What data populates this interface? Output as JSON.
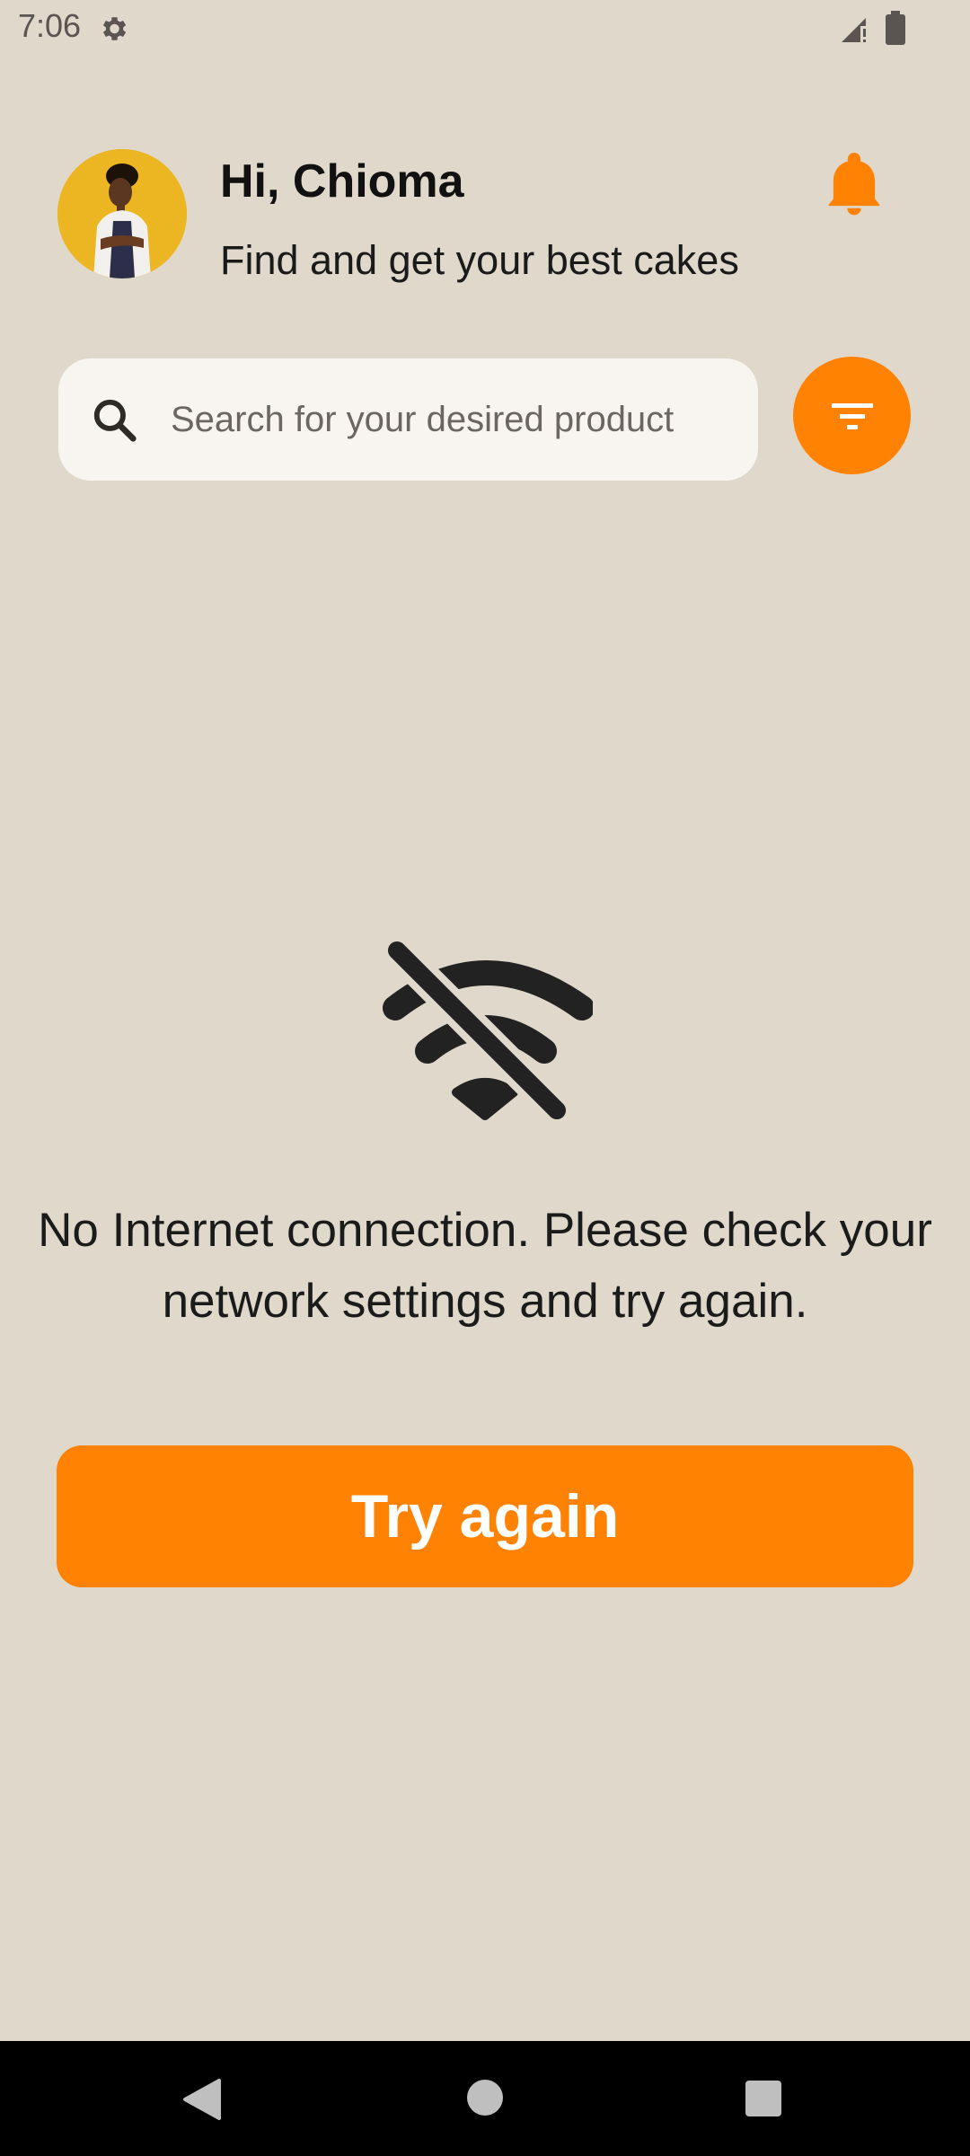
{
  "status_bar": {
    "time": "7:06"
  },
  "header": {
    "greeting": "Hi, Chioma",
    "subtitle": "Find and get your best cakes"
  },
  "search": {
    "placeholder": "Search for your desired product"
  },
  "empty_state": {
    "message": "No Internet connection. Please check your network settings and try again.",
    "retry_label": "Try again"
  },
  "colors": {
    "accent": "#ff8203",
    "background": "#e1d8cc",
    "search_bg": "#f8f5f1"
  },
  "icons": [
    "gear-icon",
    "signal-icon",
    "battery-icon",
    "bell-icon",
    "search-icon",
    "filter-icon",
    "wifi-off-icon",
    "back-icon",
    "home-icon",
    "recents-icon"
  ]
}
